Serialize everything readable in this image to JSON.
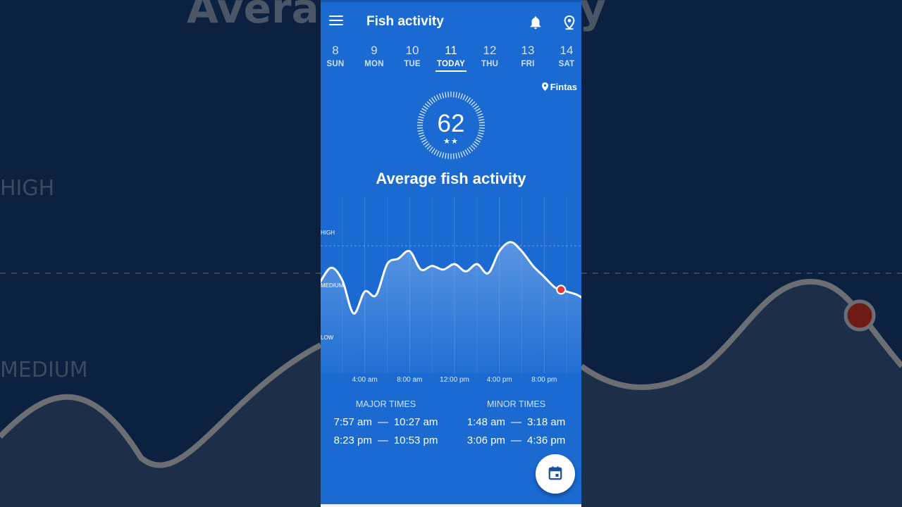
{
  "background": {
    "title_fragment": "Avera          ctivity",
    "high": "HIGH",
    "medium": "MEDIUM"
  },
  "app": {
    "title": "Fish activity",
    "icons": [
      "menu-icon",
      "bell-icon",
      "location-pin-icon",
      "calendar-icon"
    ]
  },
  "days": [
    {
      "num": "8",
      "label": "SUN"
    },
    {
      "num": "9",
      "label": "MON"
    },
    {
      "num": "10",
      "label": "TUE"
    },
    {
      "num": "11",
      "label": "TODAY",
      "selected": true
    },
    {
      "num": "12",
      "label": "THU"
    },
    {
      "num": "13",
      "label": "FRI"
    },
    {
      "num": "14",
      "label": "SAT"
    }
  ],
  "location": "Fintas",
  "score": {
    "value": "62",
    "stars": "★★",
    "label": "Average fish activity"
  },
  "chart_data": {
    "type": "area",
    "levels": [
      "HIGH",
      "MEDIUM",
      "LOW"
    ],
    "x_ticks": [
      "4:00 am",
      "8:00 am",
      "12:00 pm",
      "4:00 pm",
      "8:00 pm"
    ],
    "x_hours": [
      0,
      1,
      2,
      3,
      4,
      5,
      6,
      7,
      8,
      9,
      10,
      11,
      12,
      13,
      14,
      15,
      16,
      17,
      18,
      19,
      20,
      21,
      22,
      23
    ],
    "activity": [
      45,
      53,
      46,
      28,
      40,
      38,
      55,
      58,
      62,
      52,
      54,
      52,
      55,
      51,
      55,
      50,
      62,
      67,
      62,
      54,
      48,
      42,
      40,
      38
    ],
    "current_hour": 21.5
  },
  "major_times": {
    "label": "MAJOR TIMES",
    "rows": [
      {
        "start": "7:57 am",
        "end": "10:27 am"
      },
      {
        "start": "8:23 pm",
        "end": "10:53 pm"
      }
    ]
  },
  "minor_times": {
    "label": "MINOR TIMES",
    "rows": [
      {
        "start": "1:48 am",
        "end": "3:18 am"
      },
      {
        "start": "3:06 pm",
        "end": "4:36 pm"
      }
    ]
  },
  "dash": "—",
  "colors": {
    "accent": "#1a6ad2",
    "marker": "#e23b35",
    "fab_icon": "#1a4f9f"
  }
}
